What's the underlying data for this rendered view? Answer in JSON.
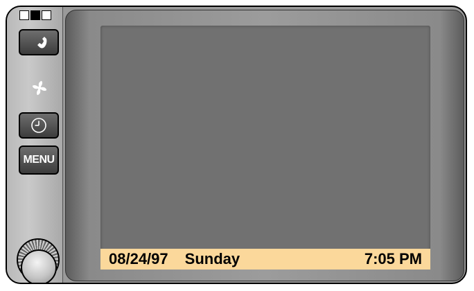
{
  "swatches": [
    {
      "color": "#ffffff"
    },
    {
      "color": "#000000"
    },
    {
      "color": "#ffffff"
    }
  ],
  "controls": {
    "phone_icon": "phone-icon",
    "fan_icon": "fan-icon",
    "clock_icon": "clock-icon",
    "menu_label": "MENU",
    "knob_icon": "rotary-knob"
  },
  "status": {
    "date": "08/24/97",
    "day": "Sunday",
    "time": "7:05 PM",
    "bar_color": "#fbd89b"
  },
  "colors": {
    "screen": "#717171",
    "bezel": "#9a9a9a"
  }
}
